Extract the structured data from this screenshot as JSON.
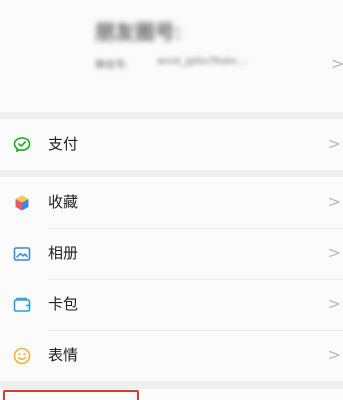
{
  "profile": {
    "name": "朋友圈号:",
    "id_label": "微信号:",
    "id_value": "wxid_jgtbcf9abc...",
    "chevron": ">"
  },
  "menu": {
    "pay": {
      "label": "支付",
      "icon": "wechat-pay-icon",
      "chevron": ">"
    },
    "favorites": {
      "label": "收藏",
      "icon": "favorites-cube-icon",
      "chevron": ">"
    },
    "album": {
      "label": "相册",
      "icon": "album-photo-icon",
      "chevron": ">"
    },
    "cards": {
      "label": "卡包",
      "icon": "card-wallet-icon",
      "chevron": ">"
    },
    "stickers": {
      "label": "表情",
      "icon": "sticker-smile-icon",
      "chevron": ">"
    }
  },
  "colors": {
    "pay_green": "#1aad19",
    "album_blue": "#3f88d6",
    "cards_teal": "#2a9fd6",
    "sticker_yellow": "#f0b23a",
    "highlight_red": "#d83a2c"
  }
}
